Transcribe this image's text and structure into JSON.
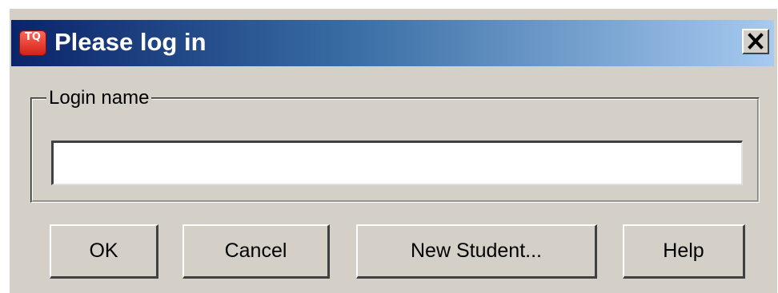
{
  "window": {
    "title": "Please log in",
    "app_icon_text": "TQ",
    "title_gradient": [
      "#0a246a",
      "#3a6ea5",
      "#a6caf0"
    ],
    "background": "#d4d0c8"
  },
  "login_group": {
    "legend": "Login name",
    "input_value": "",
    "input_placeholder": ""
  },
  "buttons": {
    "ok": "OK",
    "cancel": "Cancel",
    "new_student": "New Student...",
    "help": "Help"
  },
  "icons": {
    "app": "tq-app-icon",
    "close": "close-icon"
  }
}
